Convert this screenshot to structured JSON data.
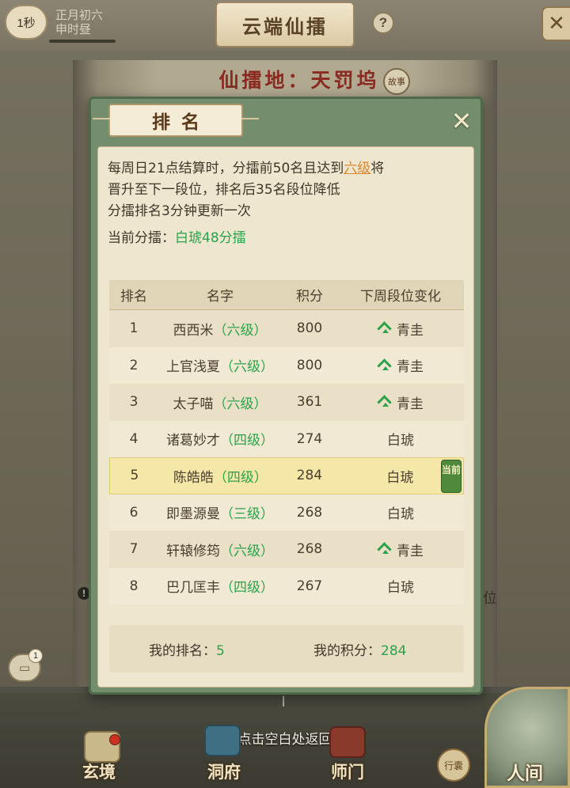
{
  "hud": {
    "timer": "1秒",
    "date_line1": "正月初六",
    "date_line2": "申时昼",
    "title": "云端仙擂",
    "help": "?",
    "close": "✕"
  },
  "scene": {
    "location": "仙擂地：天罚坞",
    "story_seal": "故事",
    "side_fragment": "位",
    "side_warning": "!",
    "chat_icon": "chat-bubble-icon",
    "chat_count": "1",
    "dismiss_hint": "点击空白处返回"
  },
  "nav": {
    "items": [
      "玄境",
      "洞府",
      "师门"
    ],
    "travel": "行囊",
    "world": "人间"
  },
  "modal": {
    "title": "排名",
    "close": "✕",
    "info": {
      "line1_before": "每周日21点结算时，分擂前50名且达到",
      "line1_highlight": "六级",
      "line1_after": "将",
      "line2": "晋升至下一段位，排名后35名段位降低",
      "line3": "分擂排名3分钟更新一次",
      "current_label": "当前分擂：",
      "current_value": "白琥48分擂"
    },
    "table": {
      "headers": [
        "排名",
        "名字",
        "积分",
        "下周段位变化"
      ],
      "rows": [
        {
          "rank": "1",
          "name": "西西米",
          "level": "（六级）",
          "score": "800",
          "change": "青圭",
          "up": true
        },
        {
          "rank": "2",
          "name": "上官浅夏",
          "level": "（六级）",
          "score": "800",
          "change": "青圭",
          "up": true
        },
        {
          "rank": "3",
          "name": "太子喵",
          "level": "（六级）",
          "score": "361",
          "change": "青圭",
          "up": true
        },
        {
          "rank": "4",
          "name": "诸葛妙才",
          "level": "（四级）",
          "score": "274",
          "change": "白琥",
          "up": false
        },
        {
          "rank": "5",
          "name": "陈皓皓",
          "level": "（四级）",
          "score": "284",
          "change": "白琥",
          "up": false,
          "current": true
        },
        {
          "rank": "6",
          "name": "即墨源曼",
          "level": "（三级）",
          "score": "268",
          "change": "白琥",
          "up": false
        },
        {
          "rank": "7",
          "name": "轩辕修筠",
          "level": "（六级）",
          "score": "268",
          "change": "青圭",
          "up": true
        },
        {
          "rank": "8",
          "name": "巴几匡丰",
          "level": "（四级）",
          "score": "267",
          "change": "白琥",
          "up": false
        }
      ],
      "current_tag": "当前"
    },
    "my": {
      "rank_label": "我的排名：",
      "rank_value": "5",
      "score_label": "我的积分：",
      "score_value": "284"
    }
  },
  "colors": {
    "accent_green": "#2ba34b",
    "highlight_orange": "#d9882a",
    "modal_frame": "#748d6c"
  }
}
